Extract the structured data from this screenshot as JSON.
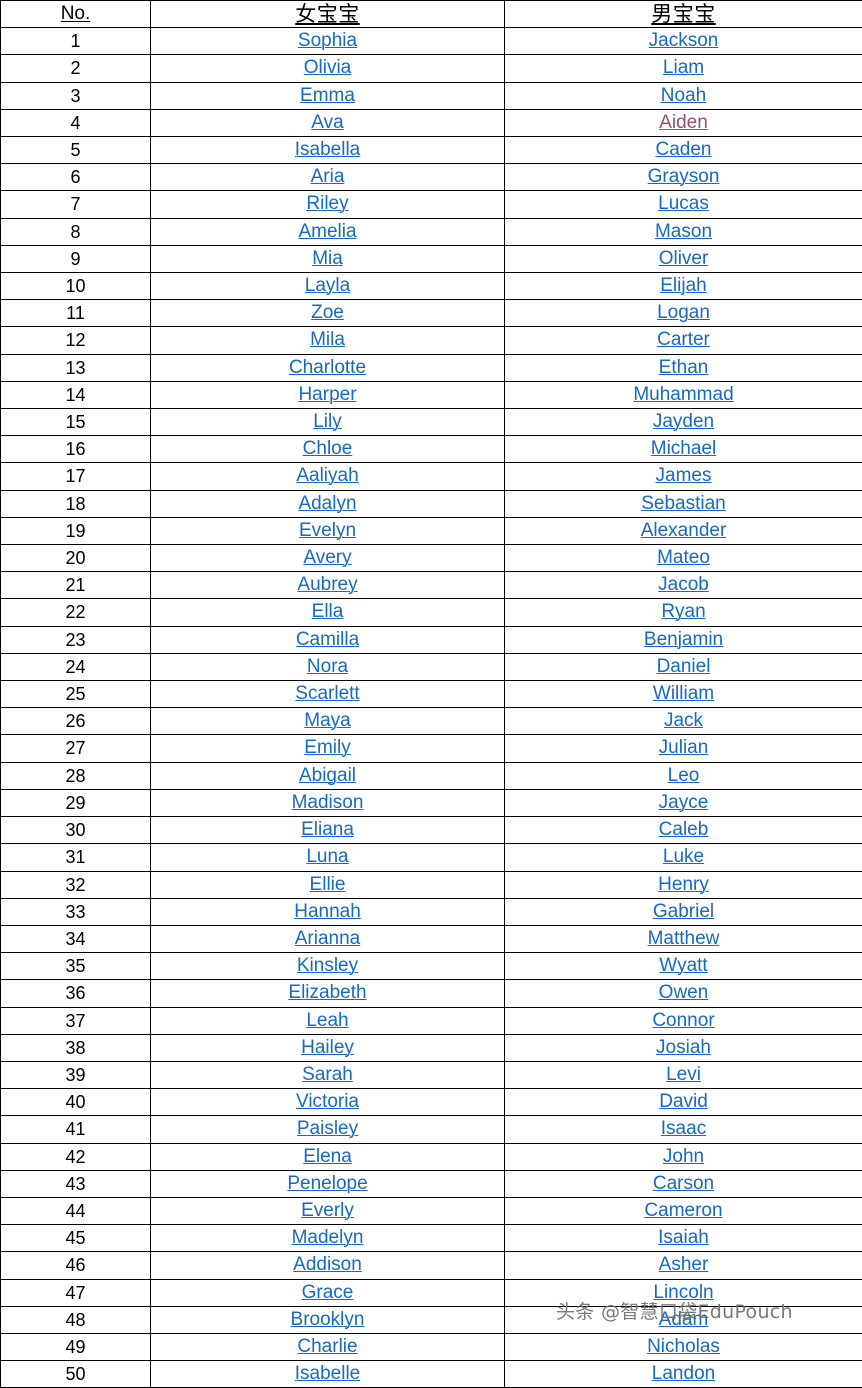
{
  "table": {
    "headers": {
      "no": "No.",
      "girl": "女宝宝",
      "boy": "男宝宝"
    },
    "colors": {
      "link": "#1569C7",
      "visited_link": "#954F72",
      "text": "#000000",
      "border": "#000000",
      "background": "#ffffff",
      "watermark": "#6f6f6f"
    },
    "thick_rule_after_rows": [
      13,
      18,
      31,
      49
    ],
    "rows": [
      {
        "no": "1",
        "girl": "Sophia",
        "boy": "Jackson",
        "boy_visited": false
      },
      {
        "no": "2",
        "girl": "Olivia",
        "boy": "Liam",
        "boy_visited": false
      },
      {
        "no": "3",
        "girl": "Emma",
        "boy": "Noah",
        "boy_visited": false
      },
      {
        "no": "4",
        "girl": "Ava",
        "boy": "Aiden",
        "boy_visited": true
      },
      {
        "no": "5",
        "girl": "Isabella",
        "boy": "Caden",
        "boy_visited": false
      },
      {
        "no": "6",
        "girl": "Aria",
        "boy": "Grayson",
        "boy_visited": false
      },
      {
        "no": "7",
        "girl": "Riley",
        "boy": "Lucas",
        "boy_visited": false
      },
      {
        "no": "8",
        "girl": "Amelia",
        "boy": "Mason",
        "boy_visited": false
      },
      {
        "no": "9",
        "girl": "Mia",
        "boy": "Oliver",
        "boy_visited": false
      },
      {
        "no": "10",
        "girl": "Layla",
        "boy": "Elijah",
        "boy_visited": false
      },
      {
        "no": "11",
        "girl": "Zoe",
        "boy": "Logan",
        "boy_visited": false
      },
      {
        "no": "12",
        "girl": "Mila",
        "boy": "Carter",
        "boy_visited": false
      },
      {
        "no": "13",
        "girl": "Charlotte",
        "boy": "Ethan",
        "boy_visited": false
      },
      {
        "no": "14",
        "girl": "Harper",
        "boy": "Muhammad",
        "boy_visited": false
      },
      {
        "no": "15",
        "girl": "Lily",
        "boy": "Jayden",
        "boy_visited": false
      },
      {
        "no": "16",
        "girl": "Chloe",
        "boy": "Michael",
        "boy_visited": false
      },
      {
        "no": "17",
        "girl": "Aaliyah",
        "boy": "James",
        "boy_visited": false
      },
      {
        "no": "18",
        "girl": "Adalyn",
        "boy": "Sebastian",
        "boy_visited": false
      },
      {
        "no": "19",
        "girl": "Evelyn",
        "boy": "Alexander",
        "boy_visited": false
      },
      {
        "no": "20",
        "girl": "Avery",
        "boy": "Mateo",
        "boy_visited": false
      },
      {
        "no": "21",
        "girl": "Aubrey",
        "boy": "Jacob",
        "boy_visited": false
      },
      {
        "no": "22",
        "girl": "Ella",
        "boy": "Ryan",
        "boy_visited": false
      },
      {
        "no": "23",
        "girl": "Camilla",
        "boy": "Benjamin",
        "boy_visited": false
      },
      {
        "no": "24",
        "girl": "Nora",
        "boy": "Daniel",
        "boy_visited": false
      },
      {
        "no": "25",
        "girl": "Scarlett",
        "boy": "William",
        "boy_visited": false
      },
      {
        "no": "26",
        "girl": "Maya",
        "boy": "Jack",
        "boy_visited": false
      },
      {
        "no": "27",
        "girl": "Emily",
        "boy": "Julian",
        "boy_visited": false
      },
      {
        "no": "28",
        "girl": "Abigail",
        "boy": "Leo",
        "boy_visited": false
      },
      {
        "no": "29",
        "girl": "Madison",
        "boy": "Jayce",
        "boy_visited": false
      },
      {
        "no": "30",
        "girl": "Eliana",
        "boy": "Caleb",
        "boy_visited": false
      },
      {
        "no": "31",
        "girl": "Luna",
        "boy": "Luke",
        "boy_visited": false
      },
      {
        "no": "32",
        "girl": "Ellie",
        "boy": "Henry",
        "boy_visited": false
      },
      {
        "no": "33",
        "girl": "Hannah",
        "boy": "Gabriel",
        "boy_visited": false
      },
      {
        "no": "34",
        "girl": "Arianna",
        "boy": "Matthew",
        "boy_visited": false
      },
      {
        "no": "35",
        "girl": "Kinsley",
        "boy": "Wyatt",
        "boy_visited": false
      },
      {
        "no": "36",
        "girl": "Elizabeth",
        "boy": "Owen",
        "boy_visited": false
      },
      {
        "no": "37",
        "girl": "Leah",
        "boy": "Connor",
        "boy_visited": false
      },
      {
        "no": "38",
        "girl": "Hailey",
        "boy": "Josiah",
        "boy_visited": false
      },
      {
        "no": "39",
        "girl": "Sarah",
        "boy": "Levi",
        "boy_visited": false
      },
      {
        "no": "40",
        "girl": "Victoria",
        "boy": "David",
        "boy_visited": false
      },
      {
        "no": "41",
        "girl": "Paisley",
        "boy": "Isaac",
        "boy_visited": false
      },
      {
        "no": "42",
        "girl": "Elena",
        "boy": "John",
        "boy_visited": false
      },
      {
        "no": "43",
        "girl": "Penelope",
        "boy": "Carson",
        "boy_visited": false
      },
      {
        "no": "44",
        "girl": "Everly",
        "boy": "Cameron",
        "boy_visited": false
      },
      {
        "no": "45",
        "girl": "Madelyn",
        "boy": "Isaiah",
        "boy_visited": false
      },
      {
        "no": "46",
        "girl": "Addison",
        "boy": "Asher",
        "boy_visited": false
      },
      {
        "no": "47",
        "girl": "Grace",
        "boy": "Lincoln",
        "boy_visited": false
      },
      {
        "no": "48",
        "girl": "Brooklyn",
        "boy": "Adam",
        "boy_visited": false
      },
      {
        "no": "49",
        "girl": "Charlie",
        "boy": "Nicholas",
        "boy_visited": false
      },
      {
        "no": "50",
        "girl": "Isabelle",
        "boy": "Landon",
        "boy_visited": false
      }
    ]
  },
  "watermark": {
    "text": "头条 @智慧口袋EduPouch"
  }
}
